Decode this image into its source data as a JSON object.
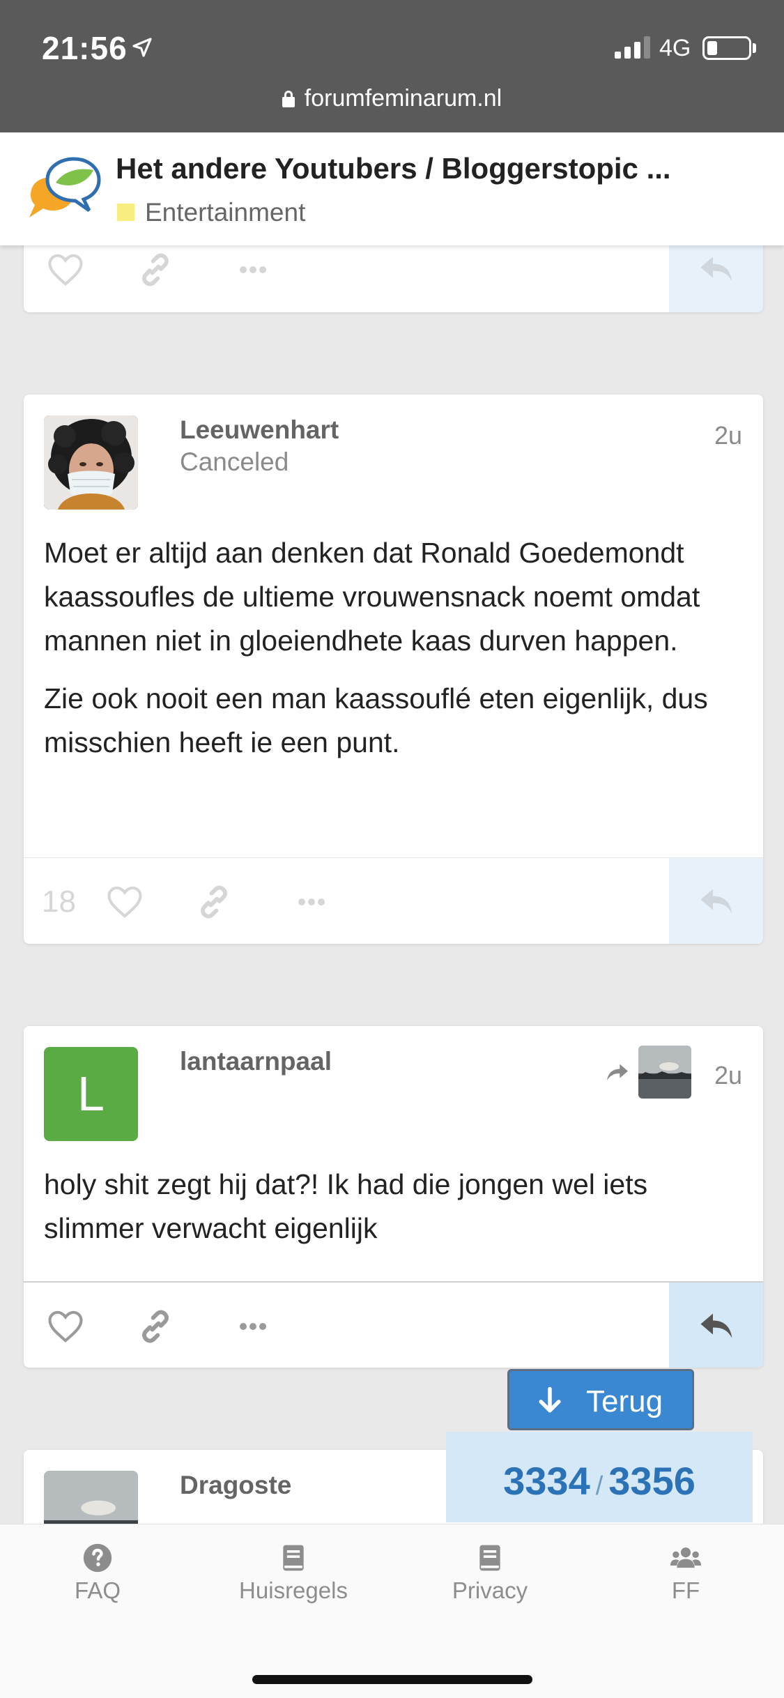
{
  "status_bar": {
    "time": "21:56",
    "network": "4G",
    "url": "forumfeminarum.nl"
  },
  "topic": {
    "title": "Het andere Youtubers / Bloggerstopic ...",
    "category": "Entertainment",
    "category_color": "#f7ee7f"
  },
  "posts": [
    {
      "username": "Leeuwenhart",
      "user_title": "Canceled",
      "date": "2u",
      "paragraphs": [
        "Moet er altijd aan denken dat Ronald Goedemondt kaassoufles de ultieme vrouwensnack noemt omdat mannen niet in gloeiendhete kaas durven happen.",
        "Zie ook nooit een man kaassouflé eten eigenlijk, dus misschien heeft ie een punt."
      ],
      "like_count": "18"
    },
    {
      "username": "lantaarnpaal",
      "avatar_letter": "L",
      "avatar_color": "#5aab43",
      "date": "2u",
      "paragraphs": [
        "holy shit zegt hij dat?! Ik had die jongen wel iets slimmer verwacht eigenlijk"
      ]
    },
    {
      "username": "Dragoste"
    }
  ],
  "controls": {
    "back_button": "Terug",
    "progress_current": "3334",
    "progress_separator": "/",
    "progress_total": "3356"
  },
  "nav": [
    {
      "label": "FAQ",
      "icon": "question-circle-icon"
    },
    {
      "label": "Huisregels",
      "icon": "book-icon"
    },
    {
      "label": "Privacy",
      "icon": "book-icon"
    },
    {
      "label": "FF",
      "icon": "users-icon"
    }
  ],
  "colors": {
    "accent": "#3a87d2",
    "progress_text": "#2b73b6",
    "reply_bg": "#e7f1fa"
  }
}
